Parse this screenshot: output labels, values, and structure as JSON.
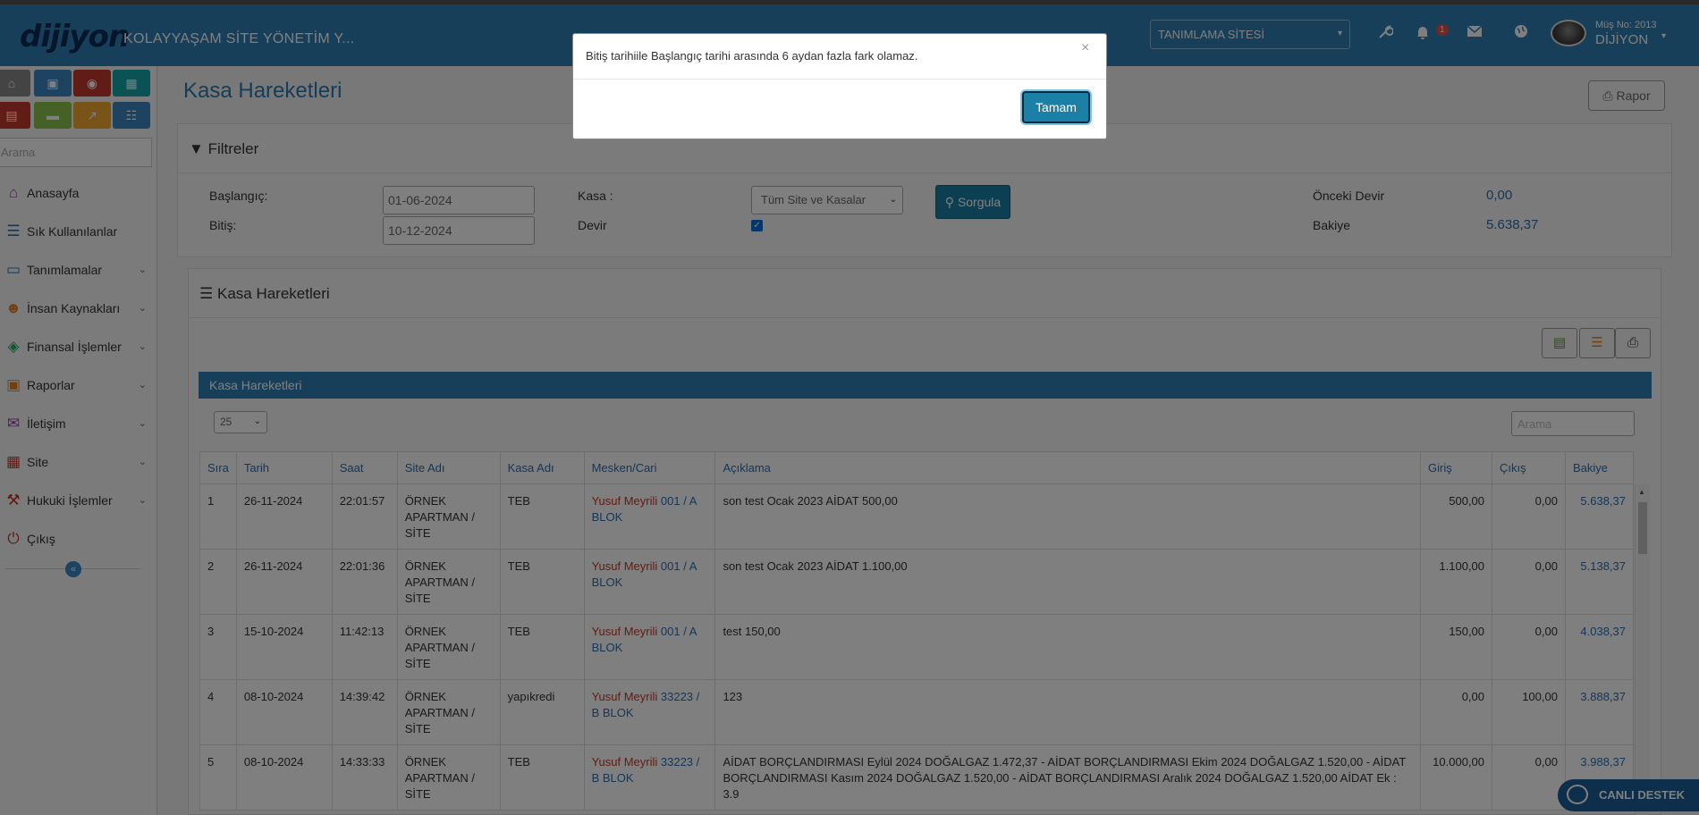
{
  "header": {
    "logo": "dijiyon",
    "site_title": "KOLAYYAŞAM SİTE YÖNETİM Y...",
    "site_select": "TANIMLAMA SİTESİ",
    "notification_count": "1",
    "user_no": "Müş No: 2013",
    "user_name": "DİJİYON"
  },
  "sidebar": {
    "search_placeholder": "Arama",
    "quick_buttons": [
      {
        "icon": "home-icon",
        "color": "#888888"
      },
      {
        "icon": "briefcase-icon",
        "color": "#3a86c1"
      },
      {
        "icon": "money-icon",
        "color": "#c0392b"
      },
      {
        "icon": "building-icon",
        "color": "#16a5a8"
      },
      {
        "icon": "bank-icon",
        "color": "#c0392b"
      },
      {
        "icon": "card-icon",
        "color": "#8bc34a"
      },
      {
        "icon": "chart-icon",
        "color": "#f0a830"
      },
      {
        "icon": "calendar-icon",
        "color": "#3a86c1"
      }
    ],
    "items": [
      {
        "label": "Anasayfa"
      },
      {
        "label": "Sık Kullanılanlar"
      },
      {
        "label": "Tanımlamalar"
      },
      {
        "label": "İnsan Kaynakları"
      },
      {
        "label": "Finansal İşlemler"
      },
      {
        "label": "Raporlar"
      },
      {
        "label": "İletişim"
      },
      {
        "label": "Site"
      },
      {
        "label": "Hukuki İşlemler"
      },
      {
        "label": "Çıkış"
      }
    ]
  },
  "page": {
    "title": "Kasa Hareketleri",
    "report_button": "Rapor"
  },
  "filters": {
    "title": "Filtreler",
    "start_label": "Başlangıç:",
    "start_value": "01-06-2024",
    "end_label": "Bitiş:",
    "end_value": "10-12-2024",
    "kasa_label": "Kasa :",
    "kasa_value": "Tüm Site ve Kasalar",
    "devir_label": "Devir",
    "devir_checked": true,
    "query_button": "Sorgula",
    "prev_devir_label": "Önceki Devir",
    "prev_devir_value": "0,00",
    "balance_label": "Bakiye",
    "balance_value": "5.638,37"
  },
  "movements": {
    "panel_title": "Kasa Hareketleri",
    "table_title": "Kasa Hareketleri",
    "page_size": "25",
    "search_placeholder": "Arama",
    "columns": [
      "Sıra",
      "Tarih",
      "Saat",
      "Site Adı",
      "Kasa Adı",
      "Mesken/Cari",
      "Açıklama",
      "Giriş",
      "Çıkış",
      "Bakiye"
    ],
    "rows": [
      {
        "sira": "1",
        "tarih": "26-11-2024",
        "saat": "22:01:57",
        "site": "ÖRNEK APARTMAN / SİTE",
        "kasa": "TEB",
        "cari_name": "Yusuf Meyrili",
        "cari_unit": "001 / A BLOK",
        "aciklama": "son test Ocak 2023 AİDAT 500,00",
        "giris": "500,00",
        "cikis": "0,00",
        "bakiye": "5.638,37"
      },
      {
        "sira": "2",
        "tarih": "26-11-2024",
        "saat": "22:01:36",
        "site": "ÖRNEK APARTMAN / SİTE",
        "kasa": "TEB",
        "cari_name": "Yusuf Meyrili",
        "cari_unit": "001 / A BLOK",
        "aciklama": "son test Ocak 2023 AİDAT 1.100,00",
        "giris": "1.100,00",
        "cikis": "0,00",
        "bakiye": "5.138,37"
      },
      {
        "sira": "3",
        "tarih": "15-10-2024",
        "saat": "11:42:13",
        "site": "ÖRNEK APARTMAN / SİTE",
        "kasa": "TEB",
        "cari_name": "Yusuf Meyrili",
        "cari_unit": "001 / A BLOK",
        "aciklama": "test 150,00",
        "giris": "150,00",
        "cikis": "0,00",
        "bakiye": "4.038,37"
      },
      {
        "sira": "4",
        "tarih": "08-10-2024",
        "saat": "14:39:42",
        "site": "ÖRNEK APARTMAN / SİTE",
        "kasa": "yapıkredi",
        "cari_name": "Yusuf Meyrili",
        "cari_unit": "33223 / B BLOK",
        "aciklama": "123",
        "giris": "0,00",
        "cikis": "100,00",
        "bakiye": "3.888,37"
      },
      {
        "sira": "5",
        "tarih": "08-10-2024",
        "saat": "14:33:33",
        "site": "ÖRNEK APARTMAN / SİTE",
        "kasa": "TEB",
        "cari_name": "Yusuf Meyrili",
        "cari_unit": "33223 / B BLOK",
        "aciklama": "AİDAT BORÇLANDIRMASI Eylül 2024 DOĞALGAZ 1.472,37 - AİDAT BORÇLANDIRMASI Ekim 2024 DOĞALGAZ 1.520,00 - AİDAT BORÇLANDIRMASI Kasım 2024 DOĞALGAZ 1.520,00 - AİDAT BORÇLANDIRMASI Aralık 2024 DOĞALGAZ 1.520,00 AİDAT Ek : 3.9",
        "giris": "10.000,00",
        "cikis": "0,00",
        "bakiye": "3.988,37"
      }
    ]
  },
  "live_support": "CANLI DESTEK",
  "modal": {
    "message": "Bitiş tarihiile Başlangıç tarihi arasında 6 aydan fazla fark olamaz.",
    "close": "×",
    "ok_button": "Tamam"
  }
}
